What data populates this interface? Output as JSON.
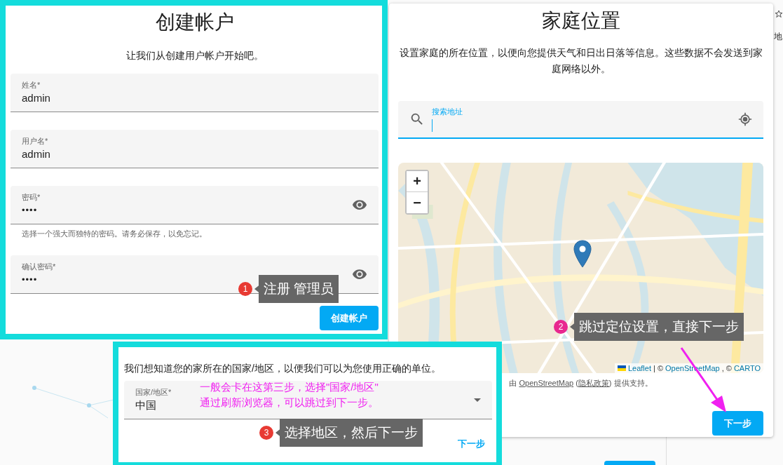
{
  "account_panel": {
    "title": "创建帐户",
    "subtitle": "让我们从创建用户帐户开始吧。",
    "fields": [
      {
        "kind": "text",
        "label": "姓名*",
        "value": "admin"
      },
      {
        "kind": "text",
        "label": "用户名*",
        "value": "admin"
      },
      {
        "kind": "password",
        "label": "密码*",
        "value": "••••",
        "helper": "选择一个强大而独特的密码。请务必保存，以免忘记。"
      },
      {
        "kind": "password",
        "label": "确认密码*",
        "value": "••••"
      }
    ],
    "submit": "创建帐户"
  },
  "location_panel": {
    "title": "家庭位置",
    "description": "设置家庭的所在位置，以便向您提供天气和日出日落等信息。这些数据不会发送到家庭网络以外。",
    "search": {
      "label": "搜索地址",
      "focused": true
    },
    "map": {
      "zoom_in": "+",
      "zoom_out": "−",
      "attribution": {
        "leaflet": "Leaflet",
        "sep": "| ©",
        "osm": "OpenStreetMap",
        "sep2": ", ©",
        "carto": "CARTO"
      }
    },
    "powered_by": {
      "before": "由 ",
      "link": "OpenStreetMap",
      "middle": " (",
      "link2": "隐私政策",
      "after": ") 提供支持。"
    },
    "next": "下一步"
  },
  "country_panel": {
    "description": "我们想知道您的家所在的国家/地区，以便我们可以为您使用正确的单位。",
    "field": {
      "label": "国家/地区*",
      "value": "中国"
    },
    "next": "下一步"
  },
  "annotations": [
    {
      "number": "1",
      "text": "注册 管理员",
      "color": "#e83a33"
    },
    {
      "number": "2",
      "text": "跳过定位设置，直接下一步",
      "color": "#e8288f"
    },
    {
      "number": "3",
      "text": "选择地区，然后下一步",
      "color": "#e83a33"
    }
  ],
  "note": [
    "一般会卡在这第三步，选择\"国家/地区\"",
    "通过刷新浏览器，可以跳过到下一步。"
  ],
  "background": {
    "fragment": "地"
  }
}
